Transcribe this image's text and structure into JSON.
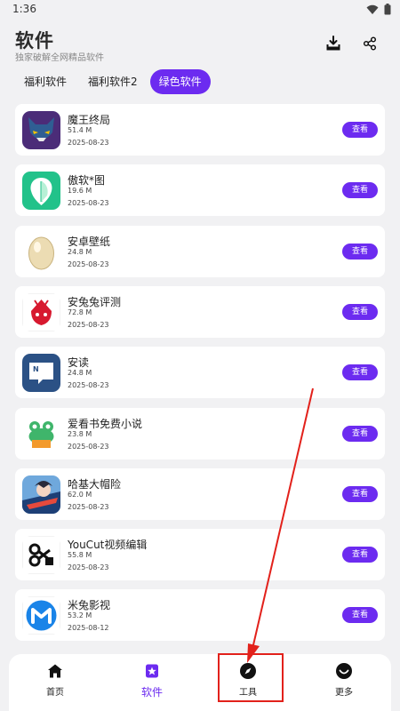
{
  "status_bar": {
    "time": "1:36"
  },
  "header": {
    "title": "软件",
    "subtitle": "独家破解全网精品软件"
  },
  "tabs": [
    {
      "label": "福利软件",
      "active": false
    },
    {
      "label": "福利软件2",
      "active": false
    },
    {
      "label": "绿色软件",
      "active": true
    }
  ],
  "apps": [
    {
      "name": "魔王终局",
      "size": "51.4 M",
      "date": "2025-08-23",
      "icon": "demon-king-icon",
      "button": "查看"
    },
    {
      "name": "傲软*图",
      "size": "19.6 M",
      "date": "2025-08-23",
      "icon": "apowersoft-icon",
      "button": "查看"
    },
    {
      "name": "安卓壁纸",
      "size": "24.8 M",
      "date": "2025-08-23",
      "icon": "wallpaper-egg-icon",
      "button": "查看"
    },
    {
      "name": "安兔兔评测",
      "size": "72.8 M",
      "date": "2025-08-23",
      "icon": "antutu-icon",
      "button": "查看"
    },
    {
      "name": "安读",
      "size": "24.8 M",
      "date": "2025-08-23",
      "icon": "andu-reader-icon",
      "button": "查看"
    },
    {
      "name": "爱看书免费小说",
      "size": "23.8 M",
      "date": "2025-08-23",
      "icon": "frog-book-icon",
      "button": "查看"
    },
    {
      "name": "哈基大帽险",
      "size": "62.0 M",
      "date": "2025-08-23",
      "icon": "anime-game-icon",
      "button": "查看"
    },
    {
      "name": "YouCut视频编辑",
      "size": "55.8 M",
      "date": "2025-08-23",
      "icon": "youcut-icon",
      "button": "查看"
    },
    {
      "name": "米兔影视",
      "size": "53.2 M",
      "date": "2025-08-12",
      "icon": "mitu-video-icon",
      "button": "查看"
    }
  ],
  "bottom_nav": [
    {
      "label": "首页",
      "icon": "home-icon",
      "active": false
    },
    {
      "label": "软件",
      "icon": "software-icon",
      "active": true
    },
    {
      "label": "工具",
      "icon": "compass-icon",
      "active": false
    },
    {
      "label": "更多",
      "icon": "more-icon",
      "active": false
    }
  ],
  "colors": {
    "accent": "#6c2bf0",
    "annotation": "#e2211b",
    "background": "#f1f1f3"
  }
}
